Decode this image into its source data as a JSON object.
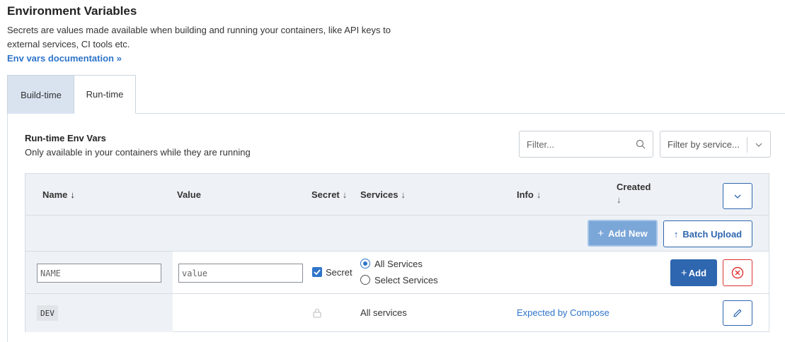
{
  "header": {
    "title": "Environment Variables",
    "description": "Secrets are values made available when building and running your containers, like API keys to external services, CI tools etc.",
    "doc_link": "Env vars documentation »"
  },
  "tabs": [
    {
      "label": "Build-time",
      "active": false
    },
    {
      "label": "Run-time",
      "active": true
    }
  ],
  "section": {
    "title": "Run-time Env Vars",
    "subtitle": "Only available in your containers while they are running",
    "filter_placeholder": "Filter...",
    "service_filter_placeholder": "Filter by service..."
  },
  "table": {
    "columns": {
      "name": "Name",
      "value": "Value",
      "secret": "Secret",
      "services": "Services",
      "info": "Info",
      "created": "Created"
    },
    "actions": {
      "add_new": "Add New",
      "batch_upload": "Batch Upload"
    },
    "new_row": {
      "name_placeholder": "NAME",
      "value_placeholder": "value",
      "secret_label": "Secret",
      "secret_checked": true,
      "service_options": [
        "All Services",
        "Select Services"
      ],
      "selected_service": "All Services",
      "add_label": "Add"
    },
    "rows": [
      {
        "name": "DEV",
        "value": "",
        "services": "All services",
        "info": "Expected by Compose"
      }
    ]
  },
  "colors": {
    "accent": "#2e74c9",
    "primary_button": "#2e66b0",
    "danger": "#dd3333",
    "header_bg": "#eef2f6"
  }
}
